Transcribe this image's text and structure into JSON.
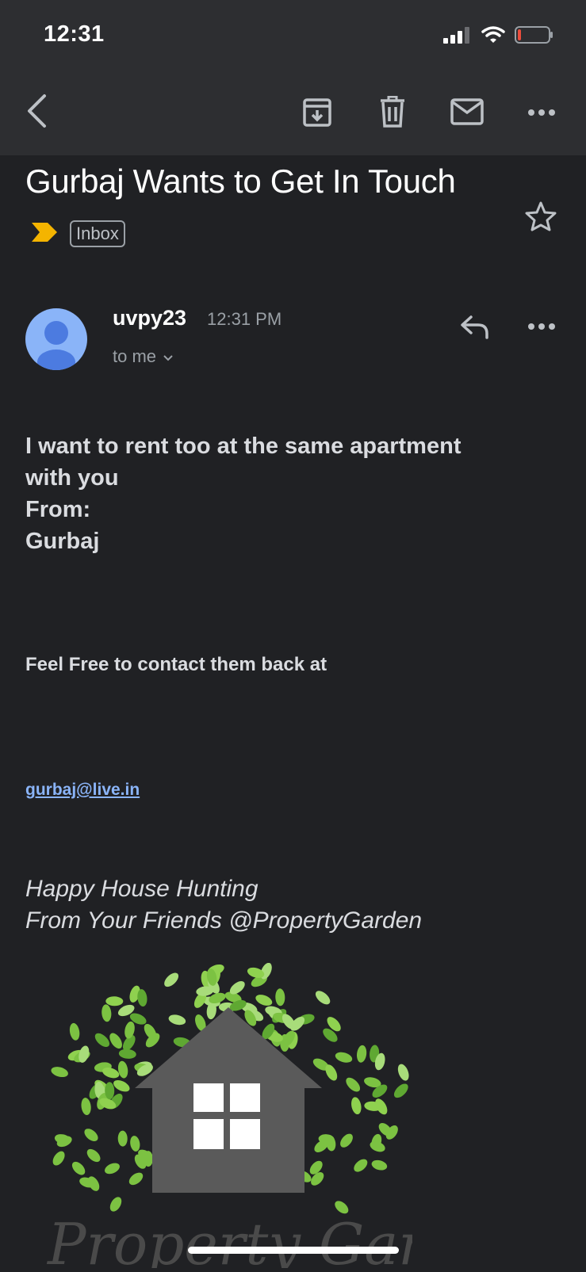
{
  "status_bar": {
    "time": "12:31"
  },
  "toolbar": {
    "back_icon": "chevron-left-icon",
    "archive_icon": "archive-icon",
    "delete_icon": "trash-icon",
    "mark_unread_icon": "mail-icon",
    "more_icon": "more-horizontal-icon"
  },
  "email": {
    "subject": "Gurbaj Wants to Get In Touch",
    "label": "Inbox",
    "sender": "uvpy23",
    "time": "12:31 PM",
    "recipient": "to me",
    "body_lines": [
      "I want to rent too at the same apartment",
      "with you",
      "From:",
      "Gurbaj"
    ],
    "contact_line": "Feel Free to contact them back at",
    "contact_email": "gurbaj@live.in",
    "signoff_lines": [
      "Happy House Hunting",
      "From Your Friends @PropertyGarden"
    ],
    "logo_text": "Property Garden"
  },
  "colors": {
    "background": "#202124",
    "topbar": "#2d2e31",
    "link": "#8ab4f8",
    "important_marker": "#f4b400"
  }
}
